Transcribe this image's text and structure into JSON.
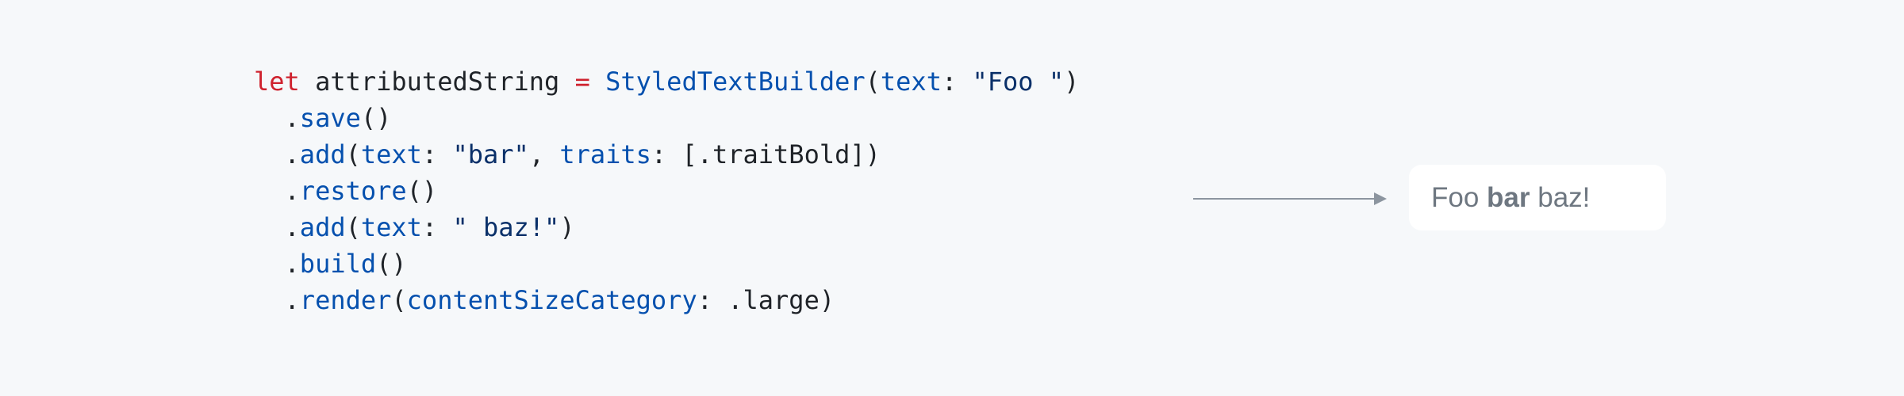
{
  "code": {
    "line1": {
      "kw": "let",
      "name": " attributedString ",
      "op": "=",
      "sp": " ",
      "type": "StyledTextBuilder",
      "paren_open": "(",
      "param": "text",
      "colon": ": ",
      "str": "\"Foo \"",
      "paren_close": ")"
    },
    "line2": {
      "dot": "  .",
      "method": "save",
      "rest": "()"
    },
    "line3": {
      "dot": "  .",
      "method": "add",
      "paren_open": "(",
      "param1": "text",
      "colon1": ": ",
      "str": "\"bar\"",
      "comma": ", ",
      "param2": "traits",
      "rest": ": [.traitBold])"
    },
    "line4": {
      "dot": "  .",
      "method": "restore",
      "rest": "()"
    },
    "line5": {
      "dot": "  .",
      "method": "add",
      "paren_open": "(",
      "param": "text",
      "colon": ": ",
      "str": "\" baz!\"",
      "paren_close": ")"
    },
    "line6": {
      "dot": "  .",
      "method": "build",
      "rest": "()"
    },
    "line7": {
      "dot": "  .",
      "method": "render",
      "paren_open": "(",
      "param": "contentSizeCategory",
      "rest": ": .large)"
    }
  },
  "result": {
    "before": "Foo ",
    "bold": "bar",
    "after": " baz!"
  },
  "colors": {
    "keyword": "#cf222e",
    "function": "#0550ae",
    "string": "#0a3069",
    "text": "#1f2328",
    "result_text": "#6e7781",
    "arrow": "#8c959f",
    "background": "#f6f8fa"
  },
  "icons": {
    "arrow": "arrow-right-icon"
  }
}
